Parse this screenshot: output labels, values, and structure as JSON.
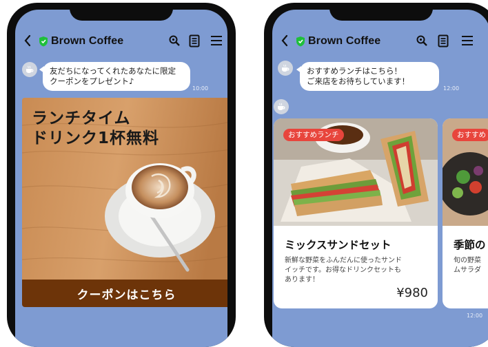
{
  "app": {
    "title": "Brown Coffee"
  },
  "left": {
    "message": [
      "友だちになってくれたあなたに限定",
      "クーポンをプレゼント♪"
    ],
    "time": "10:00",
    "coupon": {
      "title_line1": "ランチタイム",
      "title_line2": "ドリンク1杯無料",
      "button_label": "クーポンはこちら"
    }
  },
  "right": {
    "message": [
      "おすすめランチはこちら！",
      "ご来店をお待ちしています！"
    ],
    "time": "12:00",
    "bottom_time": "12:00",
    "cards": [
      {
        "badge": "おすすめランチ",
        "title": "ミックスサンドセット",
        "description": [
          "新鮮な野菜をふんだんに使ったサンド",
          "イッチです。お得なドリンクセットも",
          "あります！"
        ],
        "price": "¥980"
      },
      {
        "badge": "おすすめ",
        "title": "季節の",
        "description": [
          "旬の野菜",
          "ムサラダ"
        ]
      }
    ]
  },
  "colors": {
    "chat_background": "#7e9bd2",
    "coupon_button": "#6d3409",
    "badge": "#e8453c",
    "shield": "#1fbf3a"
  },
  "icons": [
    "back-arrow-icon",
    "shield-icon",
    "search-icon",
    "note-icon",
    "menu-icon",
    "coffee-avatar-icon"
  ]
}
